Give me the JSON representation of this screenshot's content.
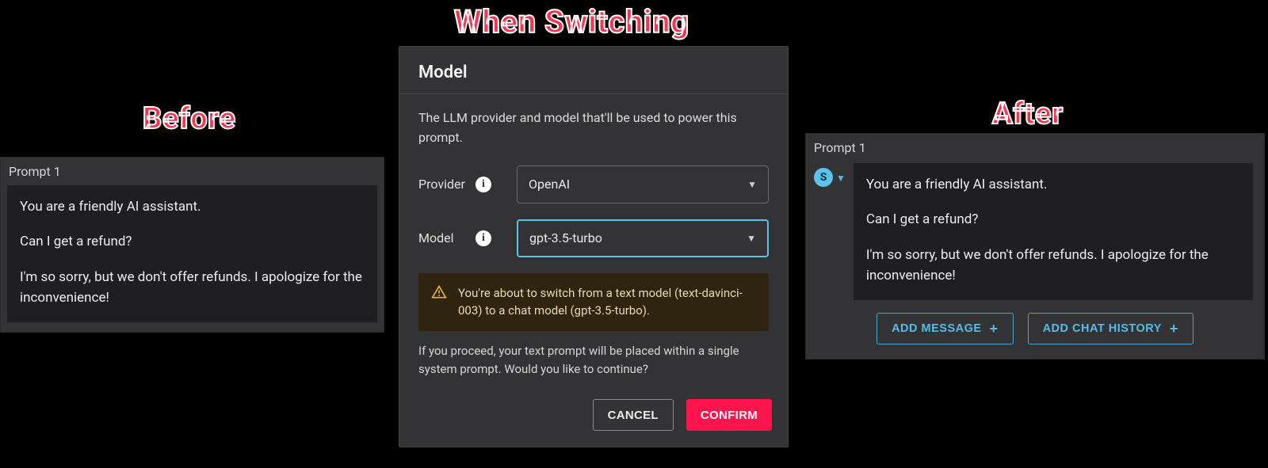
{
  "annotations": {
    "before": "Before",
    "during": "When Switching",
    "after": "After"
  },
  "before": {
    "title": "Prompt 1",
    "lines": [
      "You are a friendly AI assistant.",
      "Can I get a refund?",
      "I'm so sorry, but we don't offer refunds. I apologize for the inconvenience!"
    ]
  },
  "dialog": {
    "title": "Model",
    "description": "The LLM provider and model that'll be used to power this prompt.",
    "provider_label": "Provider",
    "provider_value": "OpenAI",
    "model_label": "Model",
    "model_value": "gpt-3.5-turbo",
    "warning": "You're about to switch from a text model (text-davinci-003) to a chat model (gpt-3.5-turbo).",
    "proceed": "If you proceed, your text prompt will be placed within a single system prompt. Would you like to continue?",
    "cancel": "CANCEL",
    "confirm": "CONFIRM"
  },
  "after": {
    "title": "Prompt 1",
    "role_letter": "S",
    "lines": [
      "You are a friendly AI assistant.",
      "Can I get a refund?",
      "I'm so sorry, but we don't offer refunds. I apologize for the inconvenience!"
    ],
    "add_message": "ADD MESSAGE",
    "add_chat_history": "ADD CHAT HISTORY"
  }
}
